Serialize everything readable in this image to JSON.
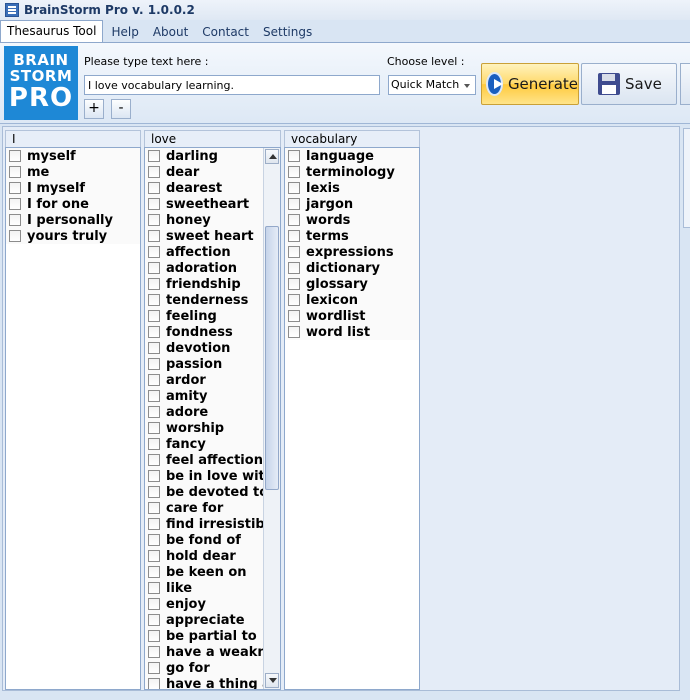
{
  "window": {
    "title": "BrainStorm Pro v. 1.0.0.2"
  },
  "menu": {
    "tabs": [
      {
        "label": "Thesaurus Tool"
      },
      {
        "label": "Help"
      },
      {
        "label": "About"
      },
      {
        "label": "Contact"
      },
      {
        "label": "Settings"
      }
    ]
  },
  "logo": {
    "line1": "BRAIN",
    "line2": "STORM",
    "line3": "PRO"
  },
  "toolbar": {
    "prompt_label": "Please type text here :",
    "text_value": "I love vocabulary learning.",
    "plus_label": "+",
    "minus_label": "-",
    "level_label": "Choose level :",
    "level_value": "Quick Match",
    "generate_label": "Generate",
    "save_label": "Save"
  },
  "columns": [
    {
      "header": "I",
      "items": [
        "myself",
        "me",
        "I myself",
        "I for one",
        "I personally",
        "yours truly"
      ]
    },
    {
      "header": "love",
      "items": [
        "darling",
        "dear",
        "dearest",
        "sweetheart",
        "honey",
        "sweet heart",
        "affection",
        "adoration",
        "friendship",
        "tenderness",
        "feeling",
        "fondness",
        "devotion",
        "passion",
        "ardor",
        "amity",
        "adore",
        "worship",
        "fancy",
        "feel affection fo",
        "be in love with",
        "be devoted to",
        "care for",
        "find irresistible",
        "be fond of",
        "hold dear",
        "be keen on",
        "like",
        "enjoy",
        "appreciate",
        "be partial to",
        "have a weakne",
        "go for",
        "have a thing ab"
      ],
      "scroll_position": 0.25
    },
    {
      "header": "vocabulary",
      "items": [
        "language",
        "terminology",
        "lexis",
        "jargon",
        "words",
        "terms",
        "expressions",
        "dictionary",
        "glossary",
        "lexicon",
        "wordlist",
        "word list"
      ]
    }
  ]
}
